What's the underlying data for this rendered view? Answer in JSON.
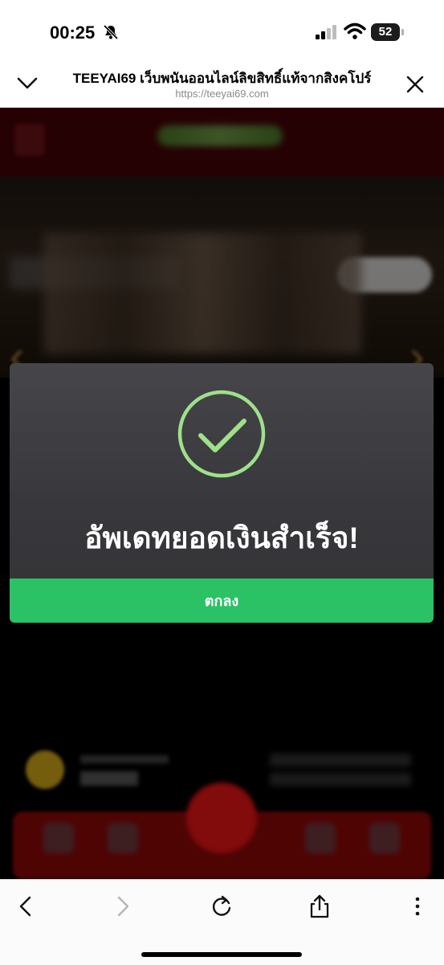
{
  "status_bar": {
    "time": "00:25",
    "battery": "52"
  },
  "browser": {
    "page_title": "TEEYAI69 เว็บพนันออนไลน์ลิขสิทธิ์แท้จากสิงคโปร์",
    "url": "https://teeyai69.com"
  },
  "dialog": {
    "message": "อัพเดทยอดเงินสำเร็จ!",
    "ok_label": "ตกลง"
  },
  "colors": {
    "success_green": "#2ac265",
    "check_ring": "#9fe08a",
    "header_red": "#3a0306"
  }
}
